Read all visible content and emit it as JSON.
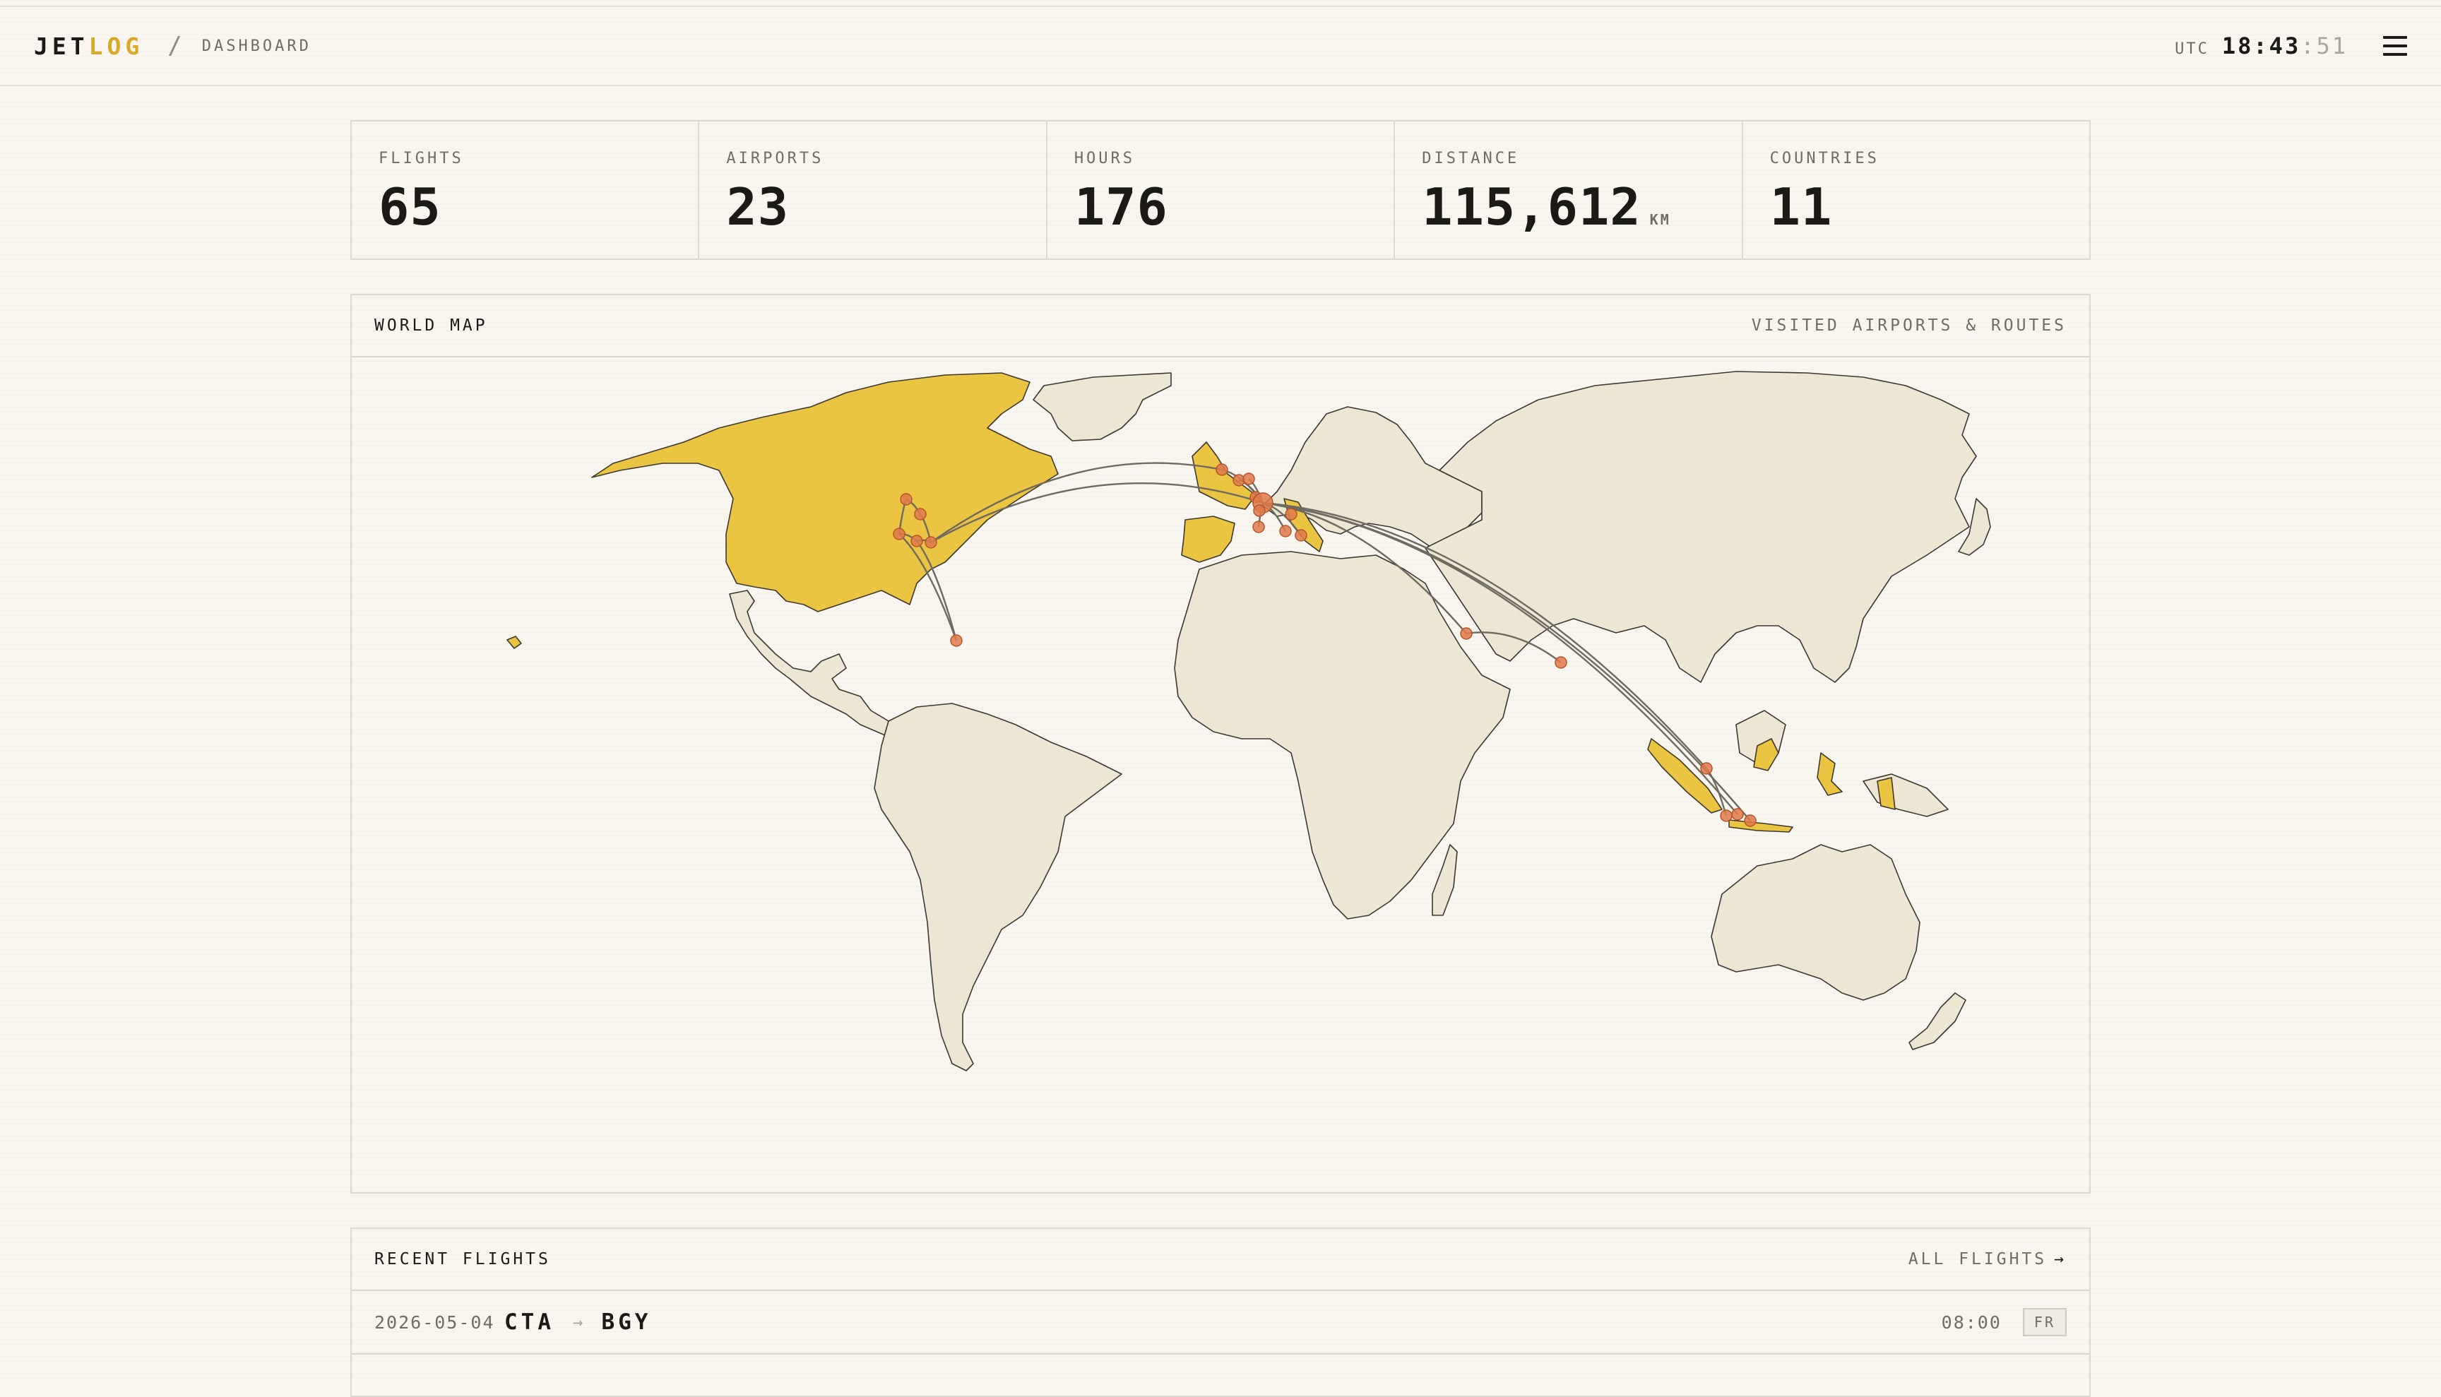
{
  "header": {
    "brand_a": "JET",
    "brand_b": "LOG",
    "separator": "/",
    "crumb": "DASHBOARD",
    "tz": "UTC",
    "time_hm": "18:43",
    "time_sec": ":51"
  },
  "stats": [
    {
      "label": "FLIGHTS",
      "value": "65",
      "unit": ""
    },
    {
      "label": "AIRPORTS",
      "value": "23",
      "unit": ""
    },
    {
      "label": "HOURS",
      "value": "176",
      "unit": ""
    },
    {
      "label": "DISTANCE",
      "value": "115,612",
      "unit": "KM"
    },
    {
      "label": "COUNTRIES",
      "value": "11",
      "unit": ""
    }
  ],
  "map": {
    "title": "WORLD MAP",
    "subtitle": "VISITED AIRPORTS & ROUTES",
    "land_color": "#ede6d2",
    "visited_color": "#ebc442",
    "route_color": "#6e6a60",
    "airport_color": "#e07a4a"
  },
  "recent": {
    "title": "RECENT FLIGHTS",
    "link_label": "ALL FLIGHTS",
    "link_icon": "→",
    "rows": [
      {
        "date": "2026-05-04",
        "from": "CTA",
        "arrow": "→",
        "to": "BGY",
        "time": "08:00",
        "badge": "FR"
      }
    ]
  }
}
